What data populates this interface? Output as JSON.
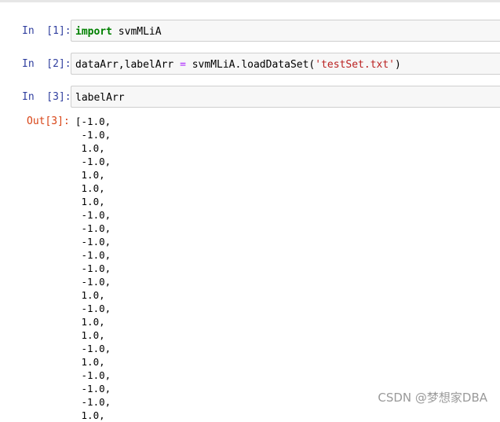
{
  "cells": [
    {
      "prompt": "In  [1]:",
      "code": {
        "keyword": "import",
        "rest": " svmMLiA"
      }
    },
    {
      "prompt": "In  [2]:",
      "code": {
        "lhs": "dataArr,labelArr ",
        "op": "=",
        "mid": " svmMLiA.loadDataSet(",
        "str": "'testSet.txt'",
        "end": ")"
      }
    },
    {
      "prompt": "In  [3]:",
      "code": {
        "text": "labelArr"
      }
    }
  ],
  "output": {
    "prompt": "Out[3]:",
    "lines": [
      "[-1.0,",
      " -1.0,",
      " 1.0,",
      " -1.0,",
      " 1.0,",
      " 1.0,",
      " 1.0,",
      " -1.0,",
      " -1.0,",
      " -1.0,",
      " -1.0,",
      " -1.0,",
      " -1.0,",
      " 1.0,",
      " -1.0,",
      " 1.0,",
      " 1.0,",
      " -1.0,",
      " 1.0,",
      " -1.0,",
      " -1.0,",
      " -1.0,",
      " 1.0,"
    ]
  },
  "watermark": "CSDN @梦想家DBA"
}
